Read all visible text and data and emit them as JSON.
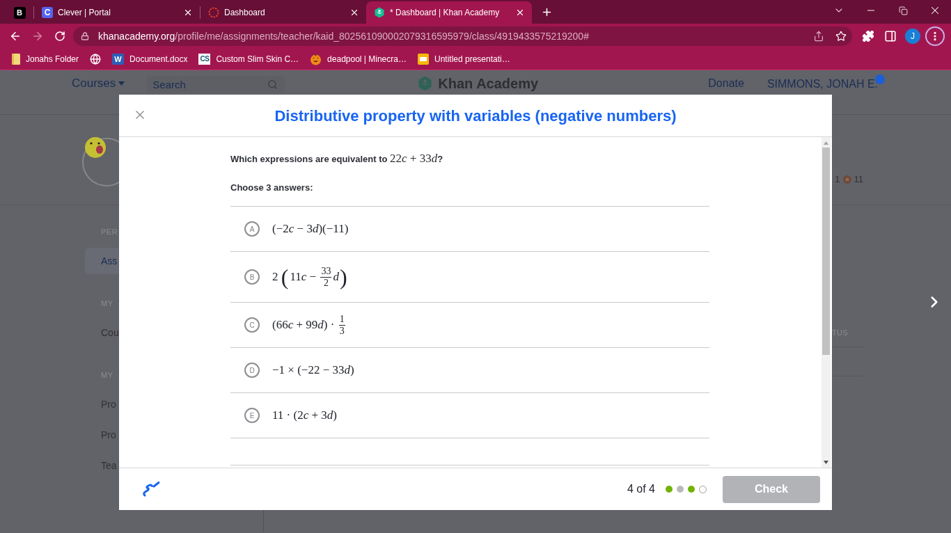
{
  "browser": {
    "tabs": [
      {
        "kind": "pinned",
        "badge": "B",
        "selected": false
      },
      {
        "kind": "tile",
        "badge": "C",
        "title": "Clever | Portal",
        "selected": false
      },
      {
        "kind": "ring",
        "title": "Dashboard",
        "selected": false
      },
      {
        "kind": "hexagon",
        "title": "* Dashboard | Khan Academy",
        "selected": true
      }
    ],
    "url": {
      "domain": "khanacademy.org",
      "path": "/profile/me/assignments/teacher/kaid_802561090002079316595979/class/4919433575219200#"
    },
    "profile_initial": "J",
    "bookmarks": [
      {
        "kind": "folder",
        "title": "Jonahs Folder"
      },
      {
        "kind": "globe"
      },
      {
        "kind": "word",
        "badge": "W",
        "title": "Document.docx"
      },
      {
        "kind": "tile",
        "badge": "CS",
        "title": "Custom Slim Skin C…"
      },
      {
        "kind": "pumpkin",
        "title": "deadpool | Minecra…"
      },
      {
        "kind": "slides",
        "title": "Untitled presentati…"
      }
    ]
  },
  "page": {
    "nav": {
      "courses": "Courses",
      "search_placeholder": "Search",
      "logo": "Khan Academy",
      "donate": "Donate",
      "user": "SIMMONS, JONAH E."
    },
    "sidebar": [
      {
        "heading": "PER",
        "items": [
          {
            "label": "Ass",
            "selected": true
          }
        ]
      },
      {
        "heading": "MY",
        "items": [
          {
            "label": "Cou",
            "selected": false
          }
        ]
      },
      {
        "heading": "MY",
        "items": [
          {
            "label": "Pro",
            "selected": false
          },
          {
            "label": "Pro",
            "selected": false
          },
          {
            "label": "Tea",
            "selected": false
          }
        ]
      }
    ],
    "stats": {
      "points": "1",
      "badges": "11"
    },
    "table": {
      "column_header": "TUS"
    }
  },
  "modal": {
    "title": "Distributive property with variables (negative numbers)",
    "question": {
      "text": "Which expressions are equivalent to ",
      "math": [
        {
          "kind": "text",
          "text": "22"
        },
        {
          "kind": "var",
          "text": "c"
        },
        {
          "kind": "text",
          "text": " + 33"
        },
        {
          "kind": "var",
          "text": "d"
        }
      ],
      "end": "?"
    },
    "instruction": "Choose 3 answers:",
    "choices": [
      {
        "letter": "A",
        "selected": false,
        "parts": [
          {
            "kind": "text",
            "text": "(−2"
          },
          {
            "kind": "var",
            "text": "c"
          },
          {
            "kind": "text",
            "text": " − 3"
          },
          {
            "kind": "var",
            "text": "d"
          },
          {
            "kind": "text",
            "text": ")(−11)"
          }
        ]
      },
      {
        "letter": "B",
        "selected": false,
        "parts": [
          {
            "kind": "text",
            "text": "2 "
          },
          {
            "kind": "group",
            "open": "(",
            "close": ")",
            "parts": [
              {
                "kind": "text",
                "text": "11"
              },
              {
                "kind": "var",
                "text": "c"
              },
              {
                "kind": "text",
                "text": " − "
              },
              {
                "kind": "frac",
                "num": "33",
                "den": "2"
              },
              {
                "kind": "var",
                "text": "d"
              }
            ]
          }
        ]
      },
      {
        "letter": "C",
        "selected": false,
        "parts": [
          {
            "kind": "text",
            "text": "(66"
          },
          {
            "kind": "var",
            "text": "c"
          },
          {
            "kind": "text",
            "text": " + 99"
          },
          {
            "kind": "var",
            "text": "d"
          },
          {
            "kind": "text",
            "text": ") · "
          },
          {
            "kind": "frac",
            "num": "1",
            "den": "3"
          }
        ]
      },
      {
        "letter": "D",
        "selected": false,
        "parts": [
          {
            "kind": "text",
            "text": "−1 × (−22 − 33"
          },
          {
            "kind": "var",
            "text": "d"
          },
          {
            "kind": "text",
            "text": ")"
          }
        ]
      },
      {
        "letter": "E",
        "selected": false,
        "parts": [
          {
            "kind": "text",
            "text": "11 · (2"
          },
          {
            "kind": "var",
            "text": "c"
          },
          {
            "kind": "text",
            "text": " + 3"
          },
          {
            "kind": "var",
            "text": "d"
          },
          {
            "kind": "text",
            "text": ")"
          }
        ]
      }
    ],
    "progress": {
      "label": "4 of 4",
      "dots": [
        {
          "kind": "filled",
          "color": "#71b307"
        },
        {
          "kind": "filled",
          "color": "#bababa"
        },
        {
          "kind": "filled",
          "color": "#71b307"
        },
        {
          "kind": "ring",
          "color": "#9b9b9b"
        }
      ]
    },
    "check_button": {
      "label": "Check",
      "disabled": true
    }
  }
}
